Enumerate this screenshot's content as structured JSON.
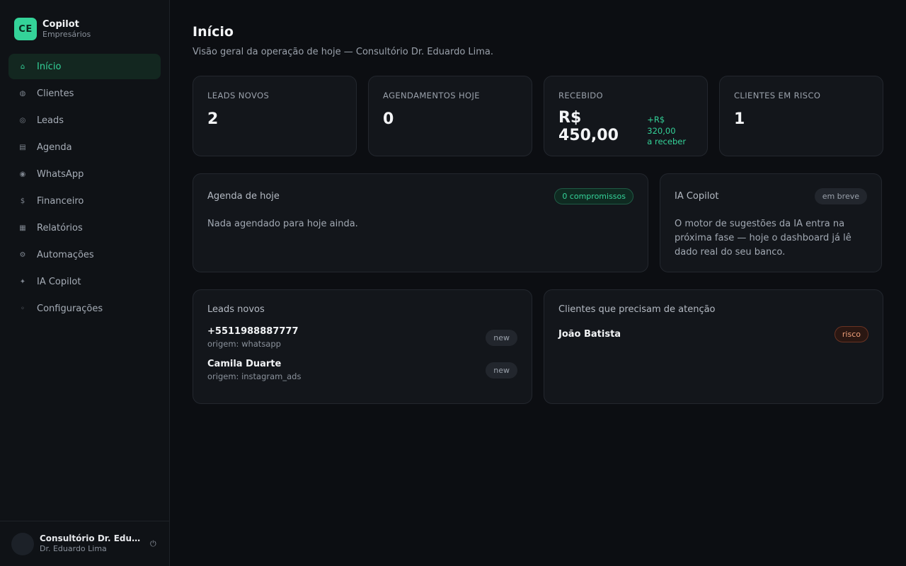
{
  "brand": {
    "logo": "CE",
    "title": "Copilot",
    "subtitle": "Empresários"
  },
  "sidebar": {
    "items": [
      {
        "label": "Início",
        "icon": "⌂",
        "icon_name": "home-icon",
        "active": true
      },
      {
        "label": "Clientes",
        "icon": "◍",
        "icon_name": "users-icon"
      },
      {
        "label": "Leads",
        "icon": "◎",
        "icon_name": "target-icon"
      },
      {
        "label": "Agenda",
        "icon": "▤",
        "icon_name": "calendar-icon"
      },
      {
        "label": "WhatsApp",
        "icon": "◉",
        "icon_name": "chat-icon"
      },
      {
        "label": "Financeiro",
        "icon": "$",
        "icon_name": "dollar-icon"
      },
      {
        "label": "Relatórios",
        "icon": "▦",
        "icon_name": "report-icon"
      },
      {
        "label": "Automações",
        "icon": "⚙",
        "icon_name": "gear-icon"
      },
      {
        "label": "IA Copilot",
        "icon": "✦",
        "icon_name": "sparkle-icon"
      },
      {
        "label": "Configurações",
        "icon": "◦",
        "icon_name": "settings-icon"
      }
    ]
  },
  "user": {
    "name": "Consultório Dr. Eduardo Lima",
    "role": "Dr. Eduardo Lima",
    "logout_icon": "⏻"
  },
  "header": {
    "title": "Início",
    "subtitle": "Visão geral da operação de hoje — Consultório Dr. Eduardo Lima."
  },
  "kpis": {
    "leads": {
      "label": "Leads novos",
      "value": "2"
    },
    "appointments": {
      "label": "Agendamentos hoje",
      "value": "0"
    },
    "received": {
      "label": "Recebido",
      "value": "R$ 450,00",
      "extra_amount": "+R$ 320,00",
      "extra_label": "a receber"
    },
    "risk": {
      "label": "Clientes em risco",
      "value": "1"
    }
  },
  "agenda": {
    "title": "Agenda de hoje",
    "badge": "0 compromissos",
    "empty": "Nada agendado para hoje ainda."
  },
  "ia": {
    "title": "IA Copilot",
    "badge": "em breve",
    "text": "O motor de sugestões da IA entra na próxima fase — hoje o dashboard já lê dado real do seu banco."
  },
  "leads_card": {
    "title": "Leads novos",
    "items": [
      {
        "title": "+5511988887777",
        "origin": "origem: whatsapp",
        "status": "new"
      },
      {
        "title": "Camila Duarte",
        "origin": "origem: instagram_ads",
        "status": "new"
      }
    ]
  },
  "clients_card": {
    "title": "Clientes que precisam de atenção",
    "items": [
      {
        "name": "João Batista",
        "status": "risco"
      }
    ]
  },
  "colors": {
    "accent": "#34d399",
    "background": "#0c0e12",
    "card": "#13161b",
    "risk": "#f0a07a"
  }
}
